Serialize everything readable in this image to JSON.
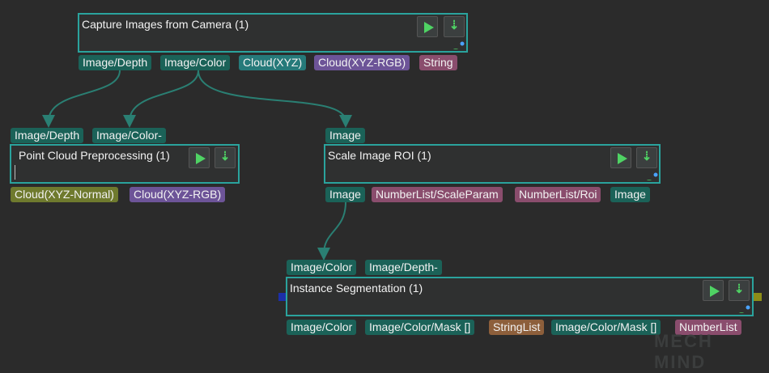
{
  "nodes": {
    "capture": {
      "title": "Capture Images from Camera (1)",
      "outputs": [
        {
          "label": "Image/Depth",
          "color": "#1b6258"
        },
        {
          "label": "Image/Color",
          "color": "#1b6258"
        },
        {
          "label": "Cloud(XYZ)",
          "color": "#267a7a"
        },
        {
          "label": "Cloud(XYZ-RGB)",
          "color": "#6d5498"
        },
        {
          "label": "String",
          "color": "#8a4d6d"
        }
      ]
    },
    "pointcloud": {
      "title": "Point Cloud Preprocessing (1)",
      "inputs": [
        {
          "label": "Image/Depth",
          "color": "#1b6258"
        },
        {
          "label": "Image/Color-",
          "color": "#1b6258"
        }
      ],
      "outputs": [
        {
          "label": "Cloud(XYZ-Normal)",
          "color": "#6f7a2e"
        },
        {
          "label": "Cloud(XYZ-RGB)",
          "color": "#6d5498"
        }
      ]
    },
    "scale": {
      "title": "Scale Image ROI (1)",
      "inputs": [
        {
          "label": "Image",
          "color": "#1b6258"
        }
      ],
      "outputs": [
        {
          "label": "Image",
          "color": "#1b6258"
        },
        {
          "label": "NumberList/ScaleParam",
          "color": "#8a4d6d"
        },
        {
          "label": "NumberList/Roi",
          "color": "#8a4d6d"
        },
        {
          "label": "Image",
          "color": "#1b6258"
        }
      ]
    },
    "instance": {
      "title": "Instance Segmentation (1)",
      "inputs": [
        {
          "label": "Image/Color",
          "color": "#1b6258"
        },
        {
          "label": "Image/Depth-",
          "color": "#1b6258"
        }
      ],
      "outputs": [
        {
          "label": "Image/Color",
          "color": "#1b6258"
        },
        {
          "label": "Image/Color/Mask []",
          "color": "#1b6258"
        },
        {
          "label": "StringList",
          "color": "#8d5f3b"
        },
        {
          "label": "Image/Color/Mask []",
          "color": "#1b6258"
        },
        {
          "label": "NumberList",
          "color": "#8a4d6d"
        }
      ]
    }
  },
  "icons": {
    "run": "play-icon",
    "download": "download-arrow-icon",
    "status": "status-indicator-icon"
  },
  "colors": {
    "node_border": "#2aa39d",
    "wire": "#2a7f73",
    "run_green": "#4fd364",
    "status_blue": "#4aa3ff",
    "left_pin": "#1c2fa8",
    "right_pin": "#8d8d18"
  },
  "watermark": "MECH MIND"
}
